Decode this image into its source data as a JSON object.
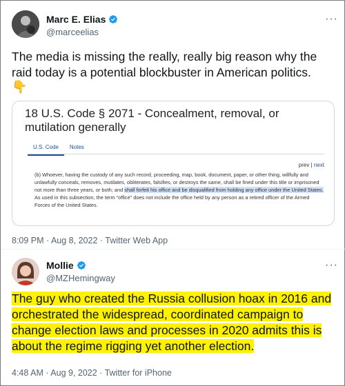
{
  "tweet1": {
    "name": "Marc E. Elias",
    "handle": "@marceelias",
    "text": "The media is missing the really, really big reason why the raid today is a potential blockbuster in American politics.",
    "emoji": "👇",
    "meta": "8:09 PM · Aug 8, 2022 · Twitter Web App",
    "card": {
      "title": "18 U.S. Code § 2071 - Concealment, removal, or mutilation generally",
      "tabs": [
        "U.S. Code",
        "Notes"
      ],
      "prev": "prev",
      "sep": " | ",
      "next": "next",
      "body_part1": "(b) Whoever, having the custody of any such record, proceeding, map, book, document, paper, or other thing, willfully and unlawfully conceals, removes, mutilates, obliterates, falsifies, or destroys the same, shall be fined under this title or imprisoned not more than three years, or both; and ",
      "body_highlight": "shall forfeit his office and be disqualified from holding any office under the United States.",
      "body_part2": " As used in this subsection, the term “office” does not include the office held by any person as a retired officer of the Armed Forces of the United States."
    }
  },
  "tweet2": {
    "name": "Mollie",
    "handle": "@MZHemingway",
    "text": "The guy who created the Russia collusion hoax in 2016 and orchestrated the widespread, coordinated campaign to change election laws and processes in 2020 admits this is about the regime rigging yet another election.",
    "meta": "4:48 AM · Aug 9, 2022 · Twitter for iPhone"
  },
  "icons": {
    "verified": "verified-badge-icon",
    "more": "more-options-icon"
  },
  "colors": {
    "verified": "#1d9bf0",
    "highlight": "#fff200",
    "link": "#1f4e9c"
  },
  "more_label": "···"
}
